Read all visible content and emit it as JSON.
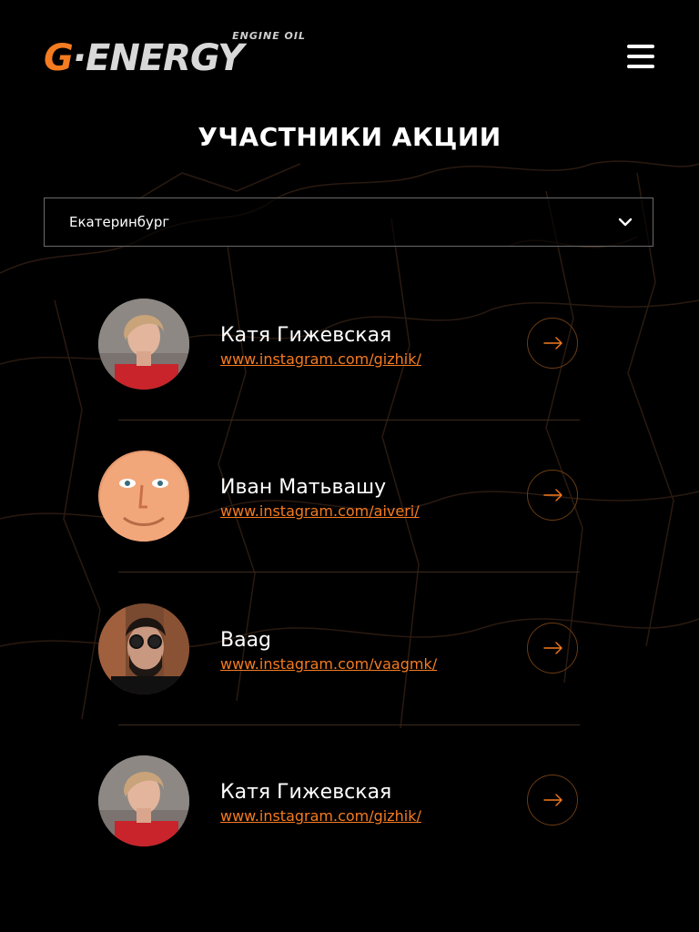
{
  "brand": {
    "logo_g": "G",
    "logo_name": "·ENERGY",
    "logo_sub": "ENGINE OIL",
    "accent_color": "#f47b20"
  },
  "header": {
    "menu_icon": "hamburger-menu-icon"
  },
  "page": {
    "title": "УЧАСТНИКИ АКЦИИ"
  },
  "filter": {
    "city": "Екатеринбург",
    "icon": "chevron-down-icon"
  },
  "participants": [
    {
      "name": "Катя Гижевская",
      "link": "www.instagram.com/gizhik/"
    },
    {
      "name": "Иван Матьвашу",
      "link": "www.instagram.com/aiveri/"
    },
    {
      "name": "Ваag",
      "link": "www.instagram.com/vaagmk/"
    },
    {
      "name": "Катя Гижевская",
      "link": "www.instagram.com/gizhik/"
    }
  ],
  "icons": {
    "arrow": "arrow-right-icon"
  }
}
